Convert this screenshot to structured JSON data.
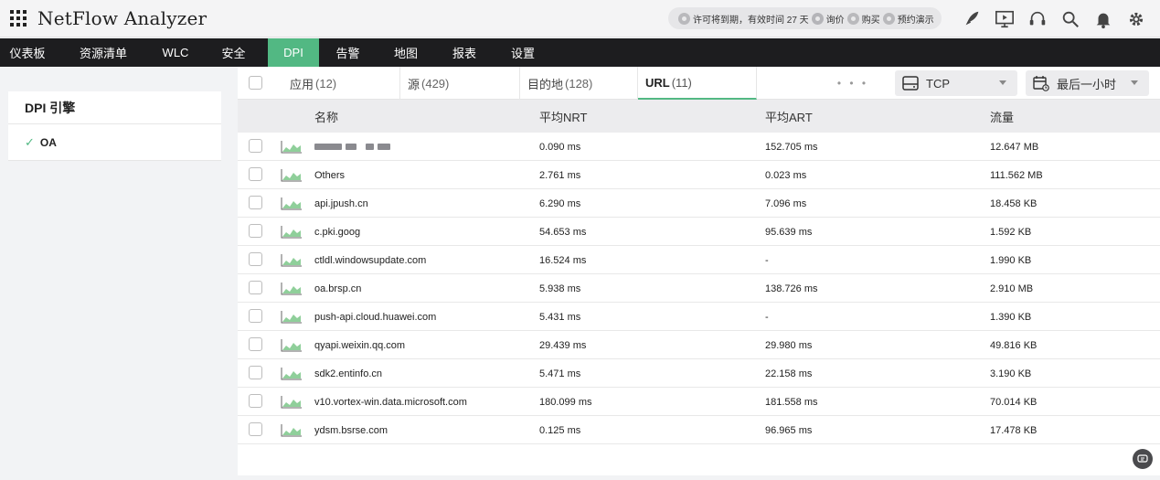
{
  "app": {
    "title": "NetFlow Analyzer"
  },
  "license": {
    "notice": "许可将到期，有效时间 27 天",
    "quote": "询价",
    "buy": "购买",
    "demo": "预约演示"
  },
  "top_icons": [
    "rocket-icon",
    "presentation-icon",
    "headset-icon",
    "search-icon",
    "bell-icon",
    "gear-icon"
  ],
  "nav": {
    "items": [
      {
        "label": "仪表板"
      },
      {
        "label": "资源清单"
      },
      {
        "label": "WLC"
      },
      {
        "label": "安全"
      },
      {
        "label": "DPI",
        "active": true
      },
      {
        "label": "告警"
      },
      {
        "label": "地图"
      },
      {
        "label": "报表"
      },
      {
        "label": "设置"
      }
    ]
  },
  "sidebar": {
    "title": "DPI 引擎",
    "items": [
      {
        "label": "OA",
        "checked": true
      }
    ]
  },
  "tabs": [
    {
      "label": "应用",
      "count": "(12)"
    },
    {
      "label": "源",
      "count": "(429)"
    },
    {
      "label": "目的地",
      "count": "(128)"
    },
    {
      "label": "URL",
      "count": "(11)",
      "active": true
    }
  ],
  "more": "• • •",
  "protocol_select": {
    "value": "TCP"
  },
  "time_select": {
    "value": "最后一小时"
  },
  "table": {
    "headers": {
      "name": "名称",
      "nrt": "平均NRT",
      "art": "平均ART",
      "traffic": "流量"
    },
    "rows": [
      {
        "name": "",
        "redacted": true,
        "nrt": "0.090 ms",
        "art": "152.705 ms",
        "traffic": "12.647 MB"
      },
      {
        "name": "Others",
        "nrt": "2.761 ms",
        "art": "0.023 ms",
        "traffic": "111.562 MB"
      },
      {
        "name": "api.jpush.cn",
        "nrt": "6.290 ms",
        "art": "7.096 ms",
        "traffic": "18.458 KB"
      },
      {
        "name": "c.pki.goog",
        "nrt": "54.653 ms",
        "art": "95.639 ms",
        "traffic": "1.592 KB"
      },
      {
        "name": "ctldl.windowsupdate.com",
        "nrt": "16.524 ms",
        "art": "-",
        "traffic": "1.990 KB"
      },
      {
        "name": "oa.brsp.cn",
        "nrt": "5.938 ms",
        "art": "138.726 ms",
        "traffic": "2.910 MB"
      },
      {
        "name": "push-api.cloud.huawei.com",
        "nrt": "5.431 ms",
        "art": "-",
        "traffic": "1.390 KB"
      },
      {
        "name": "qyapi.weixin.qq.com",
        "nrt": "29.439 ms",
        "art": "29.980 ms",
        "traffic": "49.816 KB"
      },
      {
        "name": "sdk2.entinfo.cn",
        "nrt": "5.471 ms",
        "art": "22.158 ms",
        "traffic": "3.190 KB"
      },
      {
        "name": "v10.vortex-win.data.microsoft.com",
        "nrt": "180.099 ms",
        "art": "181.558 ms",
        "traffic": "70.014 KB"
      },
      {
        "name": "ydsm.bsrse.com",
        "nrt": "0.125 ms",
        "art": "96.965 ms",
        "traffic": "17.478 KB"
      }
    ]
  },
  "colors": {
    "accent": "#52b883",
    "navbar": "#1d1d1f",
    "header_bg": "#ececee"
  }
}
